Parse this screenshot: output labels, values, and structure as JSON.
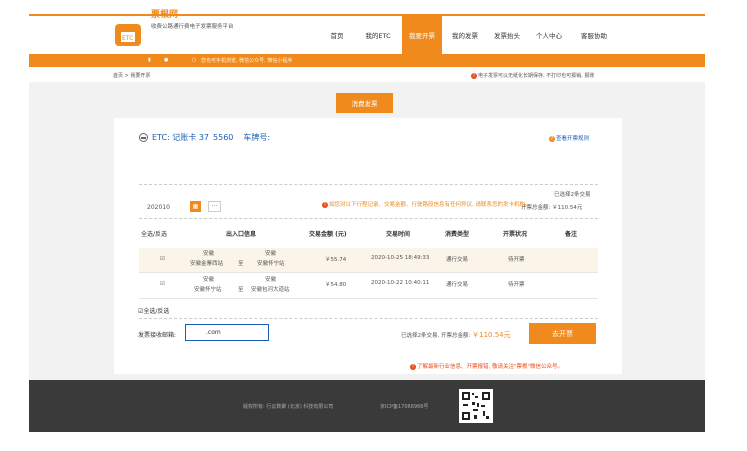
{
  "header": {
    "brand_name": "票根网",
    "brand_slogan": "收费公路通行费电子发票服务平台",
    "nav": [
      "首页",
      "我的ETC",
      "我要开票",
      "我的发票",
      "发票抬头",
      "个人中心",
      "客服协助"
    ]
  },
  "notice": {
    "text": "您也可手机浏览, 微信公众号, 微信小程序"
  },
  "breadcrumb": "首页 > 我要开票",
  "top_tip": "电子发票可以无纸化长期保存, 不打印也可报销, 报账",
  "apply_button": "消费发票",
  "account": {
    "prefix": "ETC: 记账卡 37",
    "card_suffix": "5560",
    "plate_label": "车牌号:"
  },
  "help_link": "查看开票规则",
  "filter": {
    "month": "202010",
    "calendar_icon": "calendar-icon",
    "more_label": "···",
    "hint": "如您对以下行程记录、交易金额、行驶路段信息有任何异议, 请联系您的发卡机构。",
    "selected_count": "已选择2条交易",
    "selected_total": "开票总金额: ￥110.54元"
  },
  "table": {
    "columns": [
      "全选/反选",
      "出入口信息",
      "交易金额 (元)",
      "交易时间",
      "消费类型",
      "开票状况",
      "备注"
    ],
    "rows": [
      {
        "check": "☑",
        "entry_province": "安徽",
        "entry_station": "安徽金寨西站",
        "to": "至",
        "exit_province": "安徽",
        "exit_station": "安徽怀宁站",
        "amount": "￥55.74",
        "time": "2020-10-25 18:49:33",
        "type": "通行交易",
        "status": "待开票",
        "note": ""
      },
      {
        "check": "☑",
        "entry_province": "安徽",
        "entry_station": "安徽怀宁站",
        "to": "至",
        "exit_province": "安徽",
        "exit_station": "安徽包河大道站",
        "amount": "￥54.80",
        "time": "2020-10-22 10:40:11",
        "type": "通行交易",
        "status": "待开票",
        "note": ""
      }
    ],
    "bottom_select": "☑全选/反选"
  },
  "email": {
    "label": "发票接收邮箱:",
    "value": ".com"
  },
  "summary": {
    "text": "已选择2条交易, 开票总金额:",
    "amount": "￥110.54元"
  },
  "issue_button": "去开票",
  "follow_tip": "了解最新行业信息、开票报错, 敬请关注\"票根\"微信公众号。",
  "footer": {
    "left": "版权所有: 行云数聚 (北京) 科技有限公司",
    "mid": "京ICP备17066966号"
  },
  "colors": {
    "accent": "#f08a1c",
    "link": "#1a5fb4",
    "warning": "#e84c1a"
  }
}
